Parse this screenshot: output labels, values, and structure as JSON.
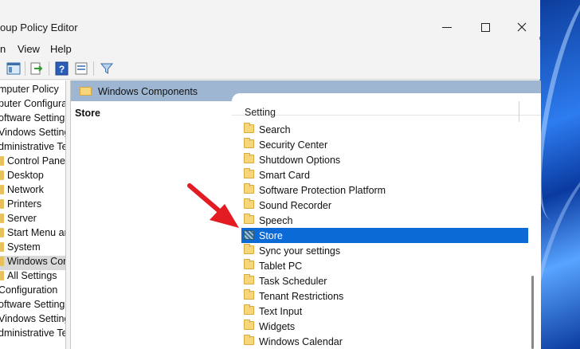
{
  "window": {
    "title": "oup Policy Editor"
  },
  "menu": [
    "n",
    "View",
    "Help"
  ],
  "tree": [
    {
      "label": "mputer Policy",
      "folder": false,
      "selected": false
    },
    {
      "label": "puter Configura",
      "folder": false,
      "selected": false
    },
    {
      "label": "oftware Settings",
      "folder": false,
      "selected": false
    },
    {
      "label": "Vindows Setting",
      "folder": false,
      "selected": false
    },
    {
      "label": "dministrative Te",
      "folder": false,
      "selected": false
    },
    {
      "label": "Control Panel",
      "folder": true,
      "selected": false
    },
    {
      "label": "Desktop",
      "folder": true,
      "selected": false
    },
    {
      "label": "Network",
      "folder": true,
      "selected": false
    },
    {
      "label": "Printers",
      "folder": true,
      "selected": false
    },
    {
      "label": "Server",
      "folder": true,
      "selected": false
    },
    {
      "label": "Start Menu ar",
      "folder": true,
      "selected": false
    },
    {
      "label": "System",
      "folder": true,
      "selected": false
    },
    {
      "label": "Windows Cor",
      "folder": true,
      "selected": true
    },
    {
      "label": "All Settings",
      "folder": true,
      "selected": false
    },
    {
      "label": "Configuration",
      "folder": false,
      "selected": false
    },
    {
      "label": "oftware Settings",
      "folder": false,
      "selected": false
    },
    {
      "label": "Vindows Setting",
      "folder": false,
      "selected": false
    },
    {
      "label": "dministrative Te",
      "folder": false,
      "selected": false
    }
  ],
  "right_pane": {
    "header": "Windows Components",
    "selected_node": "Store",
    "column_header": "Setting",
    "items": [
      {
        "label": "Search",
        "type": "folder",
        "selected": false
      },
      {
        "label": "Security Center",
        "type": "folder",
        "selected": false
      },
      {
        "label": "Shutdown Options",
        "type": "folder",
        "selected": false
      },
      {
        "label": "Smart Card",
        "type": "folder",
        "selected": false
      },
      {
        "label": "Software Protection Platform",
        "type": "folder",
        "selected": false
      },
      {
        "label": "Sound Recorder",
        "type": "folder",
        "selected": false
      },
      {
        "label": "Speech",
        "type": "folder",
        "selected": false
      },
      {
        "label": "Store",
        "type": "policy",
        "selected": true
      },
      {
        "label": "Sync your settings",
        "type": "folder",
        "selected": false
      },
      {
        "label": "Tablet PC",
        "type": "folder",
        "selected": false
      },
      {
        "label": "Task Scheduler",
        "type": "folder",
        "selected": false
      },
      {
        "label": "Tenant Restrictions",
        "type": "folder",
        "selected": false
      },
      {
        "label": "Text Input",
        "type": "folder",
        "selected": false
      },
      {
        "label": "Widgets",
        "type": "folder",
        "selected": false
      },
      {
        "label": "Windows Calendar",
        "type": "folder",
        "selected": false
      }
    ]
  },
  "colors": {
    "accent": "#0c6ad6",
    "header_bar": "#9eb6d2",
    "annotation_arrow": "#e31b23"
  }
}
